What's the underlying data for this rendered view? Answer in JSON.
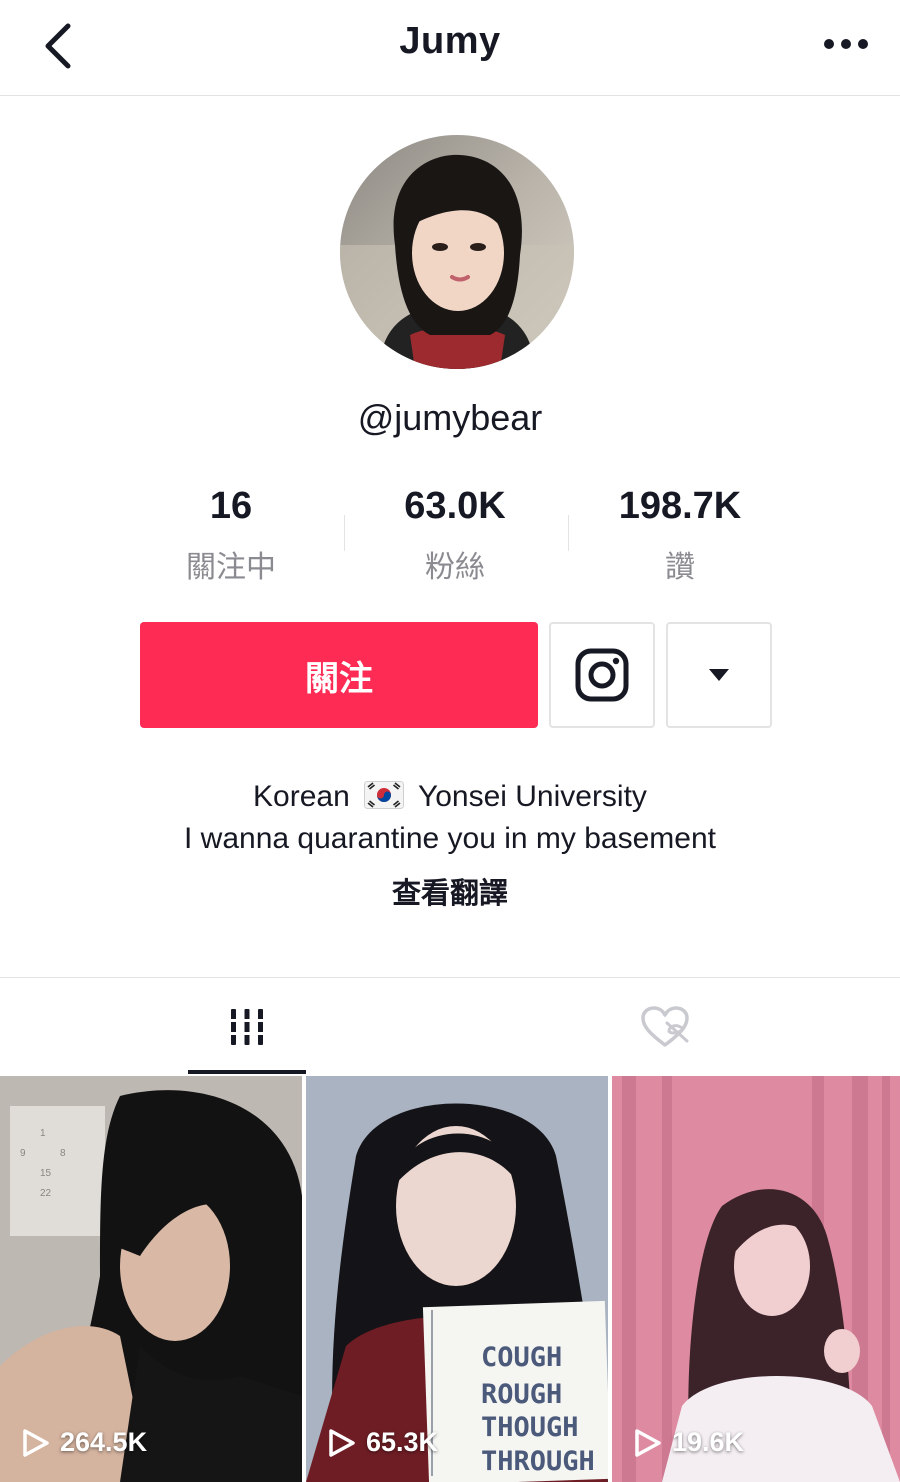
{
  "header": {
    "title": "Jumy",
    "back_icon": "chevron-left-icon",
    "more_icon": "more-horizontal-icon"
  },
  "profile": {
    "username": "@jumybear",
    "avatar_icon": "avatar-photo"
  },
  "stats": [
    {
      "value": "16",
      "label": "關注中"
    },
    {
      "value": "63.0K",
      "label": "粉絲"
    },
    {
      "value": "198.7K",
      "label": "讚"
    }
  ],
  "actions": {
    "follow_label": "關注",
    "follow_color": "#fe2c55",
    "instagram_icon": "instagram-icon",
    "dropdown_icon": "caret-down-icon"
  },
  "bio": {
    "line1_before": "Korean",
    "line1_flag": "south-korea-flag-icon",
    "line1_after": "Yonsei University",
    "line2": "I wanna quarantine you in my basement",
    "translate": "查看翻譯"
  },
  "tabs": [
    {
      "icon": "videos-grid-icon",
      "active": true
    },
    {
      "icon": "liked-videos-hidden-icon",
      "active": false
    }
  ],
  "videos": [
    {
      "views": "264.5K"
    },
    {
      "views": "65.3K",
      "card_text": [
        "COUGH",
        "ROUGH",
        "THOUGH",
        "THROUGH"
      ]
    },
    {
      "views": "19.6K"
    }
  ]
}
